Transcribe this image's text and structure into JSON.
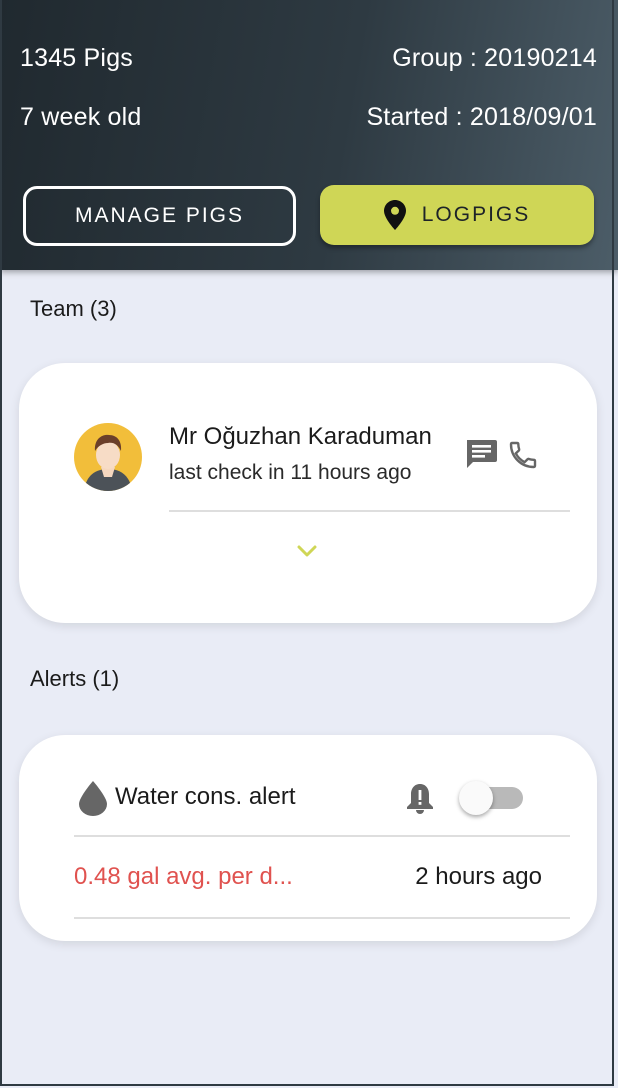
{
  "header": {
    "pig_count": "1345 Pigs",
    "group": "Group : 20190214",
    "age": "7 week old",
    "started": "Started : 2018/09/01",
    "manage_button": "MANAGE PIGS",
    "log_button": "LOGPIGS",
    "colors": {
      "accent": "#cfd656",
      "header_dark": "#20292f",
      "header_light": "#4c5d68"
    }
  },
  "team": {
    "title": "Team (3)",
    "members": [
      {
        "name": "Mr Oğuzhan Karaduman",
        "last_check": "last check in 11 hours ago",
        "icons": [
          "message-icon",
          "phone-icon"
        ]
      }
    ],
    "expand_icon": "chevron-down-icon"
  },
  "alerts": {
    "title": "Alerts (1)",
    "items": [
      {
        "name": "Water cons. alert",
        "value": "0.48 gal avg. per d...",
        "time": "2 hours ago",
        "notifications_enabled": false,
        "icons": [
          "water-drop-icon",
          "bell-alert-icon"
        ],
        "value_color": "#e0524f"
      }
    ]
  }
}
